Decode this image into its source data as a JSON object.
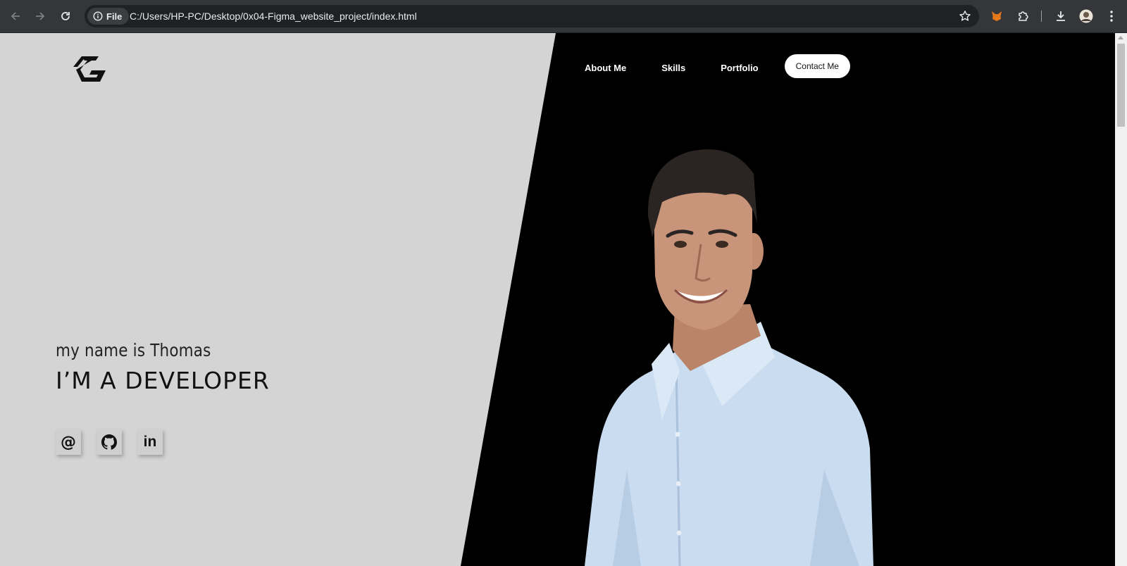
{
  "browser": {
    "back_icon": "arrow-left-icon",
    "forward_icon": "arrow-right-icon",
    "reload_icon": "reload-icon",
    "file_chip_label": "File",
    "url": "C:/Users/HP-PC/Desktop/0x04-Figma_website_project/index.html",
    "bookmark_icon": "star-icon",
    "toolbar_icons": [
      "fox-extension-icon",
      "puzzle-extensions-icon",
      "download-icon",
      "profile-avatar",
      "kebab-menu-icon"
    ]
  },
  "site": {
    "logo_icon": "tg-monogram-logo",
    "nav": {
      "about": "About Me",
      "skills": "Skills",
      "portfolio": "Portfolio",
      "contact": "Contact Me"
    },
    "hero": {
      "intro": "my name is Thomas",
      "headline": "I’M A DEVELOPER",
      "socials": [
        {
          "name": "email",
          "glyph": "@"
        },
        {
          "name": "github",
          "icon": "github-icon"
        },
        {
          "name": "linkedin",
          "glyph": "in"
        }
      ]
    },
    "colors": {
      "left_panel": "#d4d4d4",
      "right_panel": "#000000",
      "nav_text": "#ffffff",
      "button_bg": "#ffffff",
      "shirt": "#c9dcf0"
    }
  }
}
